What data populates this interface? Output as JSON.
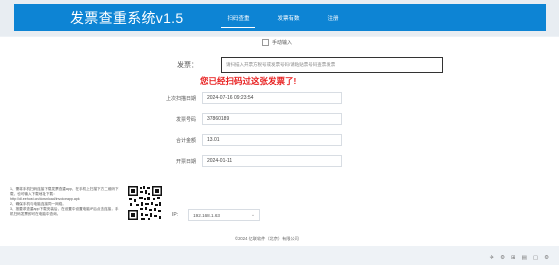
{
  "header": {
    "title": "发票查重系统v1.5",
    "nav": [
      "扫码查重",
      "发票有数",
      "注册"
    ]
  },
  "form": {
    "manual_checkbox": "手动输入",
    "invoice_label": "发票：",
    "invoice_placeholder": "请扫描入开票方税号或发票号码/请粘贴票号码查票发票",
    "notice": "您已经扫码过这张发票了!",
    "fields": [
      {
        "label": "上次扫描日期",
        "value": "2024-07-16 09:23:54"
      },
      {
        "label": "发票号码",
        "value": "37860189"
      },
      {
        "label": "合计金额",
        "value": "13.01"
      },
      {
        "label": "开票日期",
        "value": "2024-01-11"
      }
    ]
  },
  "help": {
    "text": "1、需将手机扫码连接下载发票查重app，在手机上扫描下方二维码下载，也可输入下载地址下载：http://dl.eehost.cn/download/invoiceapp.apk\n2、确保手机与电脑连接同一网络。\n3、按要求查重app下载安装后，在设置中设置电脑IP后点击连接，手机扫码发票即可在电脑中查询。"
  },
  "ip": {
    "label": "IP:",
    "value": "192.168.1.63"
  },
  "footer": {
    "copyright": "©2024 亿联软件（北京）有限公司"
  },
  "status_icons": [
    "pin-icon",
    "gear-icon",
    "grid-icon",
    "layers-icon",
    "doc-icon",
    "settings-icon"
  ]
}
